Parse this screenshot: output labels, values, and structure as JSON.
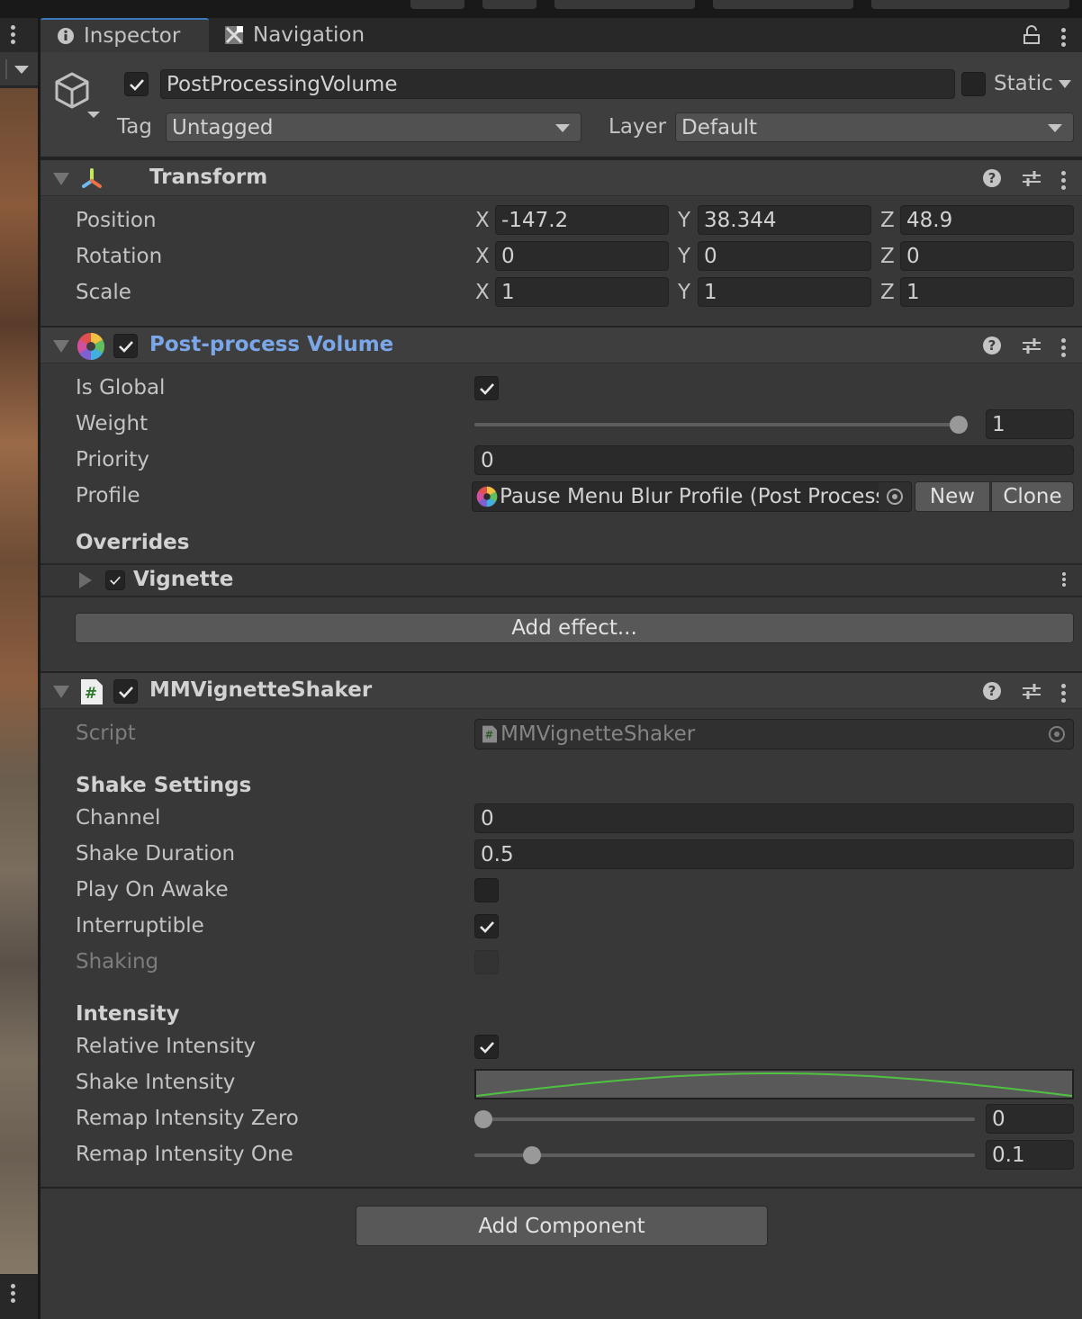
{
  "tabs": [
    {
      "label": "Inspector",
      "icon": "info-icon",
      "active": true
    },
    {
      "label": "Navigation",
      "icon": "navigation-icon",
      "active": false
    }
  ],
  "gameobject": {
    "active": true,
    "name": "PostProcessingVolume",
    "static_label": "Static",
    "static": false,
    "tag_label": "Tag",
    "tag_value": "Untagged",
    "layer_label": "Layer",
    "layer_value": "Default"
  },
  "transform": {
    "title": "Transform",
    "rows": [
      {
        "label": "Position",
        "x": "-147.2",
        "y": "38.344",
        "z": "48.9"
      },
      {
        "label": "Rotation",
        "x": "0",
        "y": "0",
        "z": "0"
      },
      {
        "label": "Scale",
        "x": "1",
        "y": "1",
        "z": "1"
      }
    ],
    "axes": [
      "X",
      "Y",
      "Z"
    ]
  },
  "postprocess": {
    "title": "Post-process Volume",
    "enabled": true,
    "is_global_label": "Is Global",
    "is_global": true,
    "weight_label": "Weight",
    "weight_value": "1",
    "weight_fraction": 1.0,
    "priority_label": "Priority",
    "priority_value": "0",
    "profile_label": "Profile",
    "profile_value": "Pause Menu Blur Profile (Post Process",
    "new_label": "New",
    "clone_label": "Clone",
    "overrides_label": "Overrides",
    "override_items": [
      {
        "label": "Vignette",
        "enabled": true
      }
    ],
    "add_effect_label": "Add effect..."
  },
  "shaker": {
    "title": "MMVignetteShaker",
    "enabled": true,
    "script_label": "Script",
    "script_value": "MMVignetteShaker",
    "shake_settings_header": "Shake Settings",
    "channel_label": "Channel",
    "channel_value": "0",
    "duration_label": "Shake Duration",
    "duration_value": "0.5",
    "play_on_awake_label": "Play On Awake",
    "play_on_awake": false,
    "interruptible_label": "Interruptible",
    "interruptible": true,
    "shaking_label": "Shaking",
    "shaking": false,
    "intensity_header": "Intensity",
    "relative_intensity_label": "Relative Intensity",
    "relative_intensity": true,
    "shake_intensity_label": "Shake Intensity",
    "curve_color": "#4fc23f",
    "remap_zero_label": "Remap Intensity Zero",
    "remap_zero_value": "0",
    "remap_zero_fraction": 0.0,
    "remap_one_label": "Remap Intensity One",
    "remap_one_value": "0.1",
    "remap_one_fraction": 0.1
  },
  "add_component_label": "Add Component"
}
